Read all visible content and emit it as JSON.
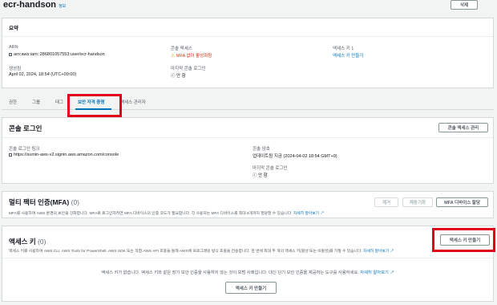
{
  "header": {
    "title": "ecr-handson",
    "info": "정보",
    "delete_label": "삭제"
  },
  "summary": {
    "heading": "요약",
    "arn_label": "ARN",
    "arn_value": "arn:aws:iam::286801057553:user/ecr-handson",
    "console_access_label": "콘솔 액세스",
    "console_access_value": "MFA 없이 활성화됨",
    "access_key_label": "액세스 키 1",
    "access_key_value": "액세스 키 만들기",
    "created_label": "생성됨",
    "created_value": "April 02, 2024, 18:54 (UTC+09:00)",
    "last_login_label": "마지막 콘솔 로그인",
    "last_login_value": "안 함"
  },
  "tabs": [
    {
      "label": "권한"
    },
    {
      "label": "그룹"
    },
    {
      "label": "태그"
    },
    {
      "label": "보안 자격 증명"
    },
    {
      "label": "액세스 관리자"
    }
  ],
  "console_login": {
    "heading": "콘솔 로그인",
    "manage_button": "콘솔 액세스 관리",
    "link_label": "콘솔 로그인 링크",
    "link_value": "https://sumin-aws-v2.signin.aws.amazon.com/console",
    "password_label": "콘솔 암호",
    "password_value": "업데이트됨 지금 (2024-04-02 18:54 GMT+9)",
    "last_login_label": "마지막 콘솔 로그인",
    "last_login_value": "안 함"
  },
  "mfa": {
    "heading": "멀티 팩터 인증(MFA)",
    "count": "(0)",
    "remove_button": "제거",
    "resync_button": "재동기화",
    "assign_button": "MFA 디바이스 할당",
    "description": "MFA를 사용하여 AWS 환경의 보안을 강화합니다. MFA로 로그인하려면 MFA 디바이스의 인증 코드가 필요합니다. 각 사용자는 MFA 디바이스를 최대 8개까지 할당할 수 있습니다.",
    "learn_more": "자세히 알아보기"
  },
  "access_keys": {
    "heading": "액세스 키",
    "count": "(0)",
    "create_button": "액세스 키 만들기",
    "description": "액세스 키를 사용하여 AWS CLI, AWS Tools for PowerShell, AWS SDK 또는 직접 AWS API 호출을 통해 AWS에 프로그래밍 방식 호출을 전송합니다. 한 번에 최대 두 개의 액세스 키(활성 또는 비활성)를 가질 수 있습니다.",
    "learn_more": "자세히 알아보기",
    "empty_text": "액세스 키가 없습니다. 액세스 키와 같은 장기 보안 인증을 사용하지 않는 것이 모범 사례입니다. 대신 단기 보안 인증을 제공하는 도구를 사용하세요.",
    "empty_learn_more": "자세히 알아보기",
    "empty_button": "액세스 키 만들기"
  },
  "colors": {
    "link": "#0073bb",
    "warning": "#ff9900",
    "highlight": "#e0001b"
  }
}
